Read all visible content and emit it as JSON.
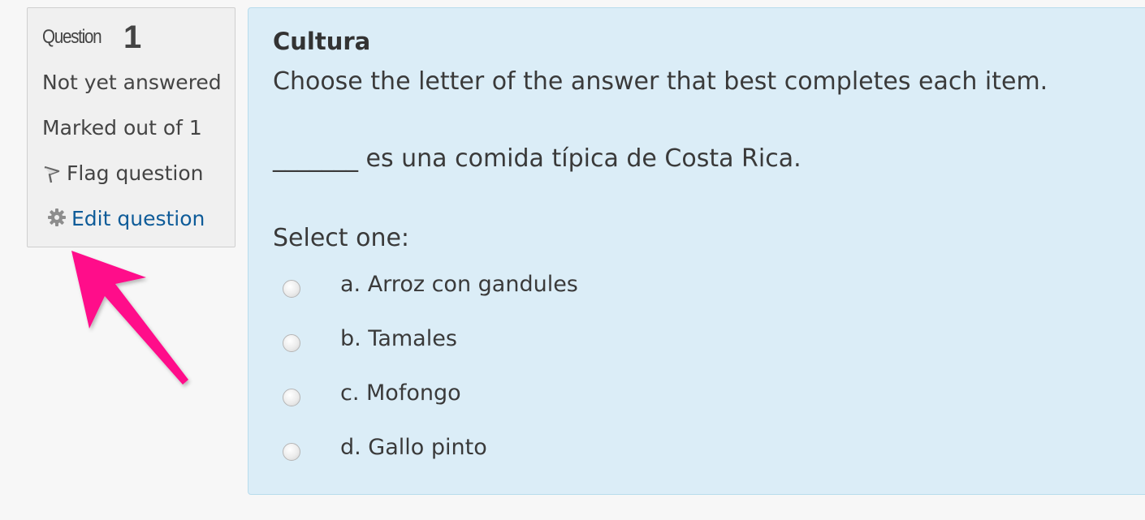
{
  "info": {
    "question_word": "Question",
    "question_number": "1",
    "state": "Not yet answered",
    "grade": "Marked out of 1",
    "flag_label": "Flag question",
    "edit_label": "Edit question"
  },
  "question": {
    "title": "Cultura",
    "prompt": "Choose the letter of the answer that best completes each item.",
    "stem": "_______ es una comida típica de Costa Rica.",
    "select_label": "Select one:",
    "options": [
      {
        "label": "a. Arroz con gandules"
      },
      {
        "label": "b. Tamales"
      },
      {
        "label": "c. Mofongo"
      },
      {
        "label": "d. Gallo pinto"
      }
    ]
  },
  "colors": {
    "arrow": "#ff0a8a",
    "link": "#0f5c99",
    "panel": "#dbedf7"
  }
}
